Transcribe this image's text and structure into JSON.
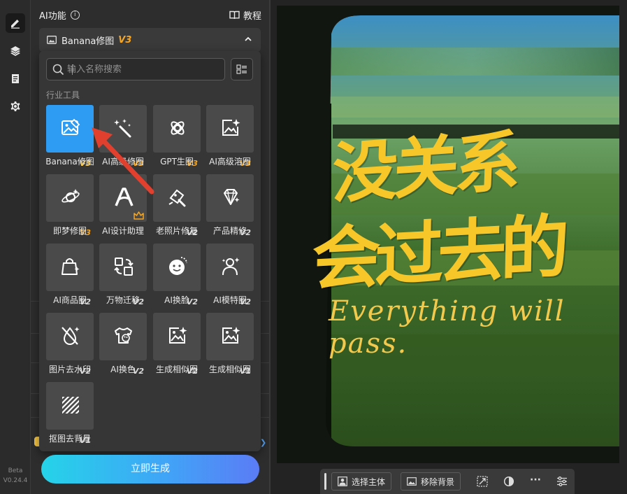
{
  "rail": {
    "version_label": "Beta",
    "version_number": "V0.24.4"
  },
  "panel": {
    "title": "AI功能",
    "info_glyph": "i",
    "tutorial_label": "教程"
  },
  "section": {
    "name": "Banana修图",
    "tag": "V3"
  },
  "popup": {
    "search_placeholder": "输入名称搜索",
    "category_label": "行业工具",
    "tools": [
      {
        "label": "Banana修图",
        "version": "V3",
        "icon": "image-edit-icon",
        "selected": true
      },
      {
        "label": "AI高级修图",
        "version": "V3",
        "icon": "magic-wand-icon"
      },
      {
        "label": "GPT生图",
        "version": "V3",
        "icon": "gpt-knot-icon"
      },
      {
        "label": "AI高级溶图",
        "version": "V3",
        "icon": "image-sparkle-icon"
      },
      {
        "label": "即梦修图",
        "version": "V3",
        "icon": "dream-planet-icon"
      },
      {
        "label": "AI设计助理",
        "version": "",
        "icon": "design-a-icon",
        "badge": "crown-icon"
      },
      {
        "label": "老照片修复",
        "version": "V2",
        "icon": "photo-repair-icon"
      },
      {
        "label": "产品精修",
        "version": "V2",
        "icon": "diamond-icon"
      },
      {
        "label": "AI商品图",
        "version": "V2",
        "icon": "shopping-bag-icon"
      },
      {
        "label": "万物迁移",
        "version": "V2",
        "icon": "transfer-icon"
      },
      {
        "label": "AI换脸",
        "version": "V2",
        "icon": "face-swap-icon"
      },
      {
        "label": "AI模特图",
        "version": "V2",
        "icon": "model-person-icon"
      },
      {
        "label": "图片去水印",
        "version": "V2",
        "icon": "watermark-remove-icon"
      },
      {
        "label": "AI换色",
        "version": "V2",
        "icon": "palette-shirt-icon"
      },
      {
        "label": "生成相似图",
        "version": "V2",
        "icon": "similar-image-icon"
      },
      {
        "label": "生成相似图",
        "version": "V1",
        "icon": "similar-image-icon"
      },
      {
        "label": "抠图去背景",
        "version": "V1",
        "icon": "remove-bg-icon"
      }
    ]
  },
  "generate_label": "立即生成",
  "poster": {
    "line1": "没关系",
    "line2": "会过去的",
    "line3": "Everything will pass."
  },
  "toolbar": {
    "select_subject": "选择主体",
    "remove_background": "移除背景",
    "more": "···"
  },
  "colors": {
    "accent": "#2f9cf4",
    "version_tag": "#f5a623",
    "poster_yellow": "#f7c72a",
    "generate_gradient_start": "#25d3e8",
    "generate_gradient_end": "#5b7cf6"
  }
}
